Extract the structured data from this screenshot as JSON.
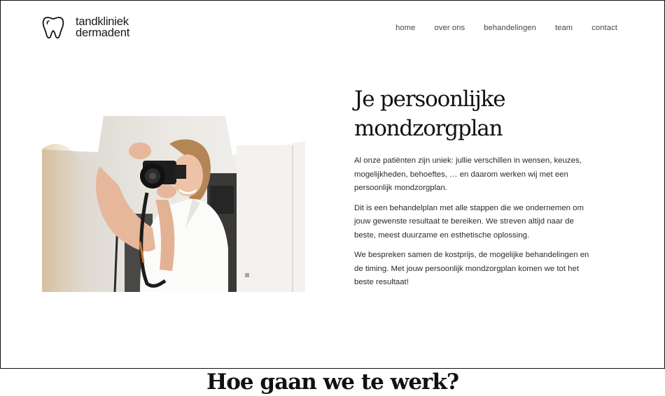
{
  "brand": {
    "line1": "tandkliniek",
    "line2": "dermadent",
    "icon": "tooth-icon"
  },
  "nav": {
    "items": [
      {
        "label": "home"
      },
      {
        "label": "over ons"
      },
      {
        "label": "behandelingen"
      },
      {
        "label": "team"
      },
      {
        "label": "contact"
      }
    ]
  },
  "hero": {
    "title_line1": "Je persoonlijke",
    "title_line2": "mondzorgplan",
    "paragraphs": [
      "Al onze patiënten zijn uniek: jullie verschillen in wensen, keuzes, mogelijkheden, behoeftes, … en daarom werken wij met een persoonlijk mondzorgplan.",
      "Dit is een behandelplan met alle stappen die we ondernemen om jouw gewenste resultaat te bereiken. We streven altijd naar de beste, meest duurzame en esthetische oplossing.",
      "We bespreken samen de kostprijs, de mogelijke behandelingen en de timing. Met jouw persoonlijk mondzorgplan komen we tot het beste resultaat!"
    ]
  },
  "section2": {
    "heading": "Hoe gaan we te werk?"
  }
}
